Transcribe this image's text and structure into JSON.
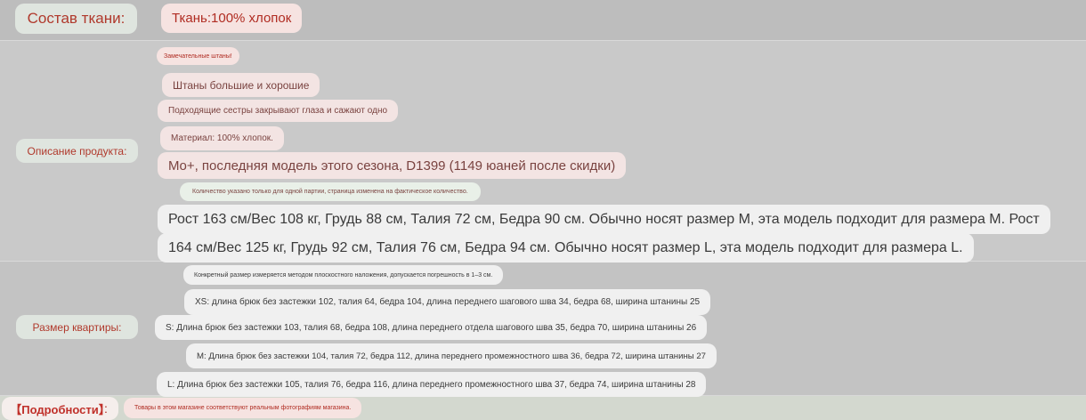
{
  "fabric": {
    "label": "Состав ткани:",
    "value": "Ткань:100% хлопок"
  },
  "description": {
    "label": "Описание продукта:",
    "lines": [
      "Замечательные штаны!",
      "Штаны большие и хорошие",
      "Подходящие сестры закрывают глаза и сажают одно",
      "Материал: 100% хлопок.",
      "Mo+, последняя модель этого сезона, D1399 (1149 юаней после скидки)",
      "Количество указано только для одной партии, страница изменена на фактическое количество."
    ],
    "model_line_1": "Рост 163 см/Вес 108 кг, Грудь 88 см, Талия 72 см, Бедра 90 см. Обычно носят размер M, эта модель подходит для размера M. Рост",
    "model_line_2": "164 см/Вес 125 кг, Грудь 92 см, Талия 76 см, Бедра 94 см. Обычно носят размер L, эта модель подходит для размера L."
  },
  "sizes": {
    "label": "Размер квартиры:",
    "note": "Конкретный размер измеряется методом плоскостного наложения, допускается погрешность в 1–3 см.",
    "rows": [
      "XS: длина брюк без застежки 102, талия 64, бедра 104, длина переднего шагового шва 34, бедра 68, ширина штанины 25",
      "S: Длина брюк без застежки 103, талия 68, бедра 108, длина переднего отдела шагового шва 35, бедра 70, ширина штанины 26",
      "M: Длина брюк без застежки 104, талия 72, бедра 112, длина переднего промежностного шва 36, бедра 72, ширина штанины 27",
      "L: Длина брюк без застежки 105, талия 76, бедра 116, длина переднего промежностного шва 37, бедра 74, ширина штанины 28"
    ]
  },
  "details": {
    "label": "【Подробности】",
    "colon": ":",
    "value": "Товары в этом магазине соответствуют реальным фотографиям магазина."
  }
}
